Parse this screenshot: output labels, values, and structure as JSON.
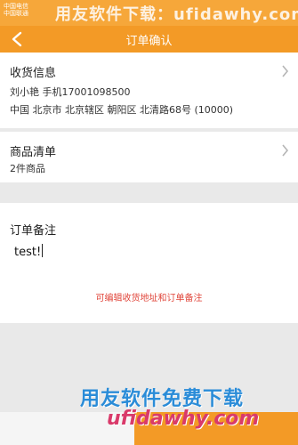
{
  "status_bar": {
    "carrier_line1": "中国电信",
    "carrier_line2": "中国联通"
  },
  "watermarks": {
    "top": "用友软件下载：ufidawhy.com",
    "bottom_title": "用友软件免费下载",
    "bottom_url": "ufidawhy.com"
  },
  "header": {
    "title": "订单确认",
    "back_icon": "chevron-left-icon"
  },
  "shipping": {
    "title": "收货信息",
    "recipient": "刘小艳 手机17001098500",
    "address": "中国 北京市 北京辖区 朝阳区 北清路68号 (10000)"
  },
  "items": {
    "title": "商品清单",
    "count_text": "2件商品"
  },
  "note": {
    "title": "订单备注",
    "value": "test!"
  },
  "hint": "可编辑收货地址和订单备注",
  "colors": {
    "accent": "#f39a26",
    "hint_red": "#e0453a"
  }
}
